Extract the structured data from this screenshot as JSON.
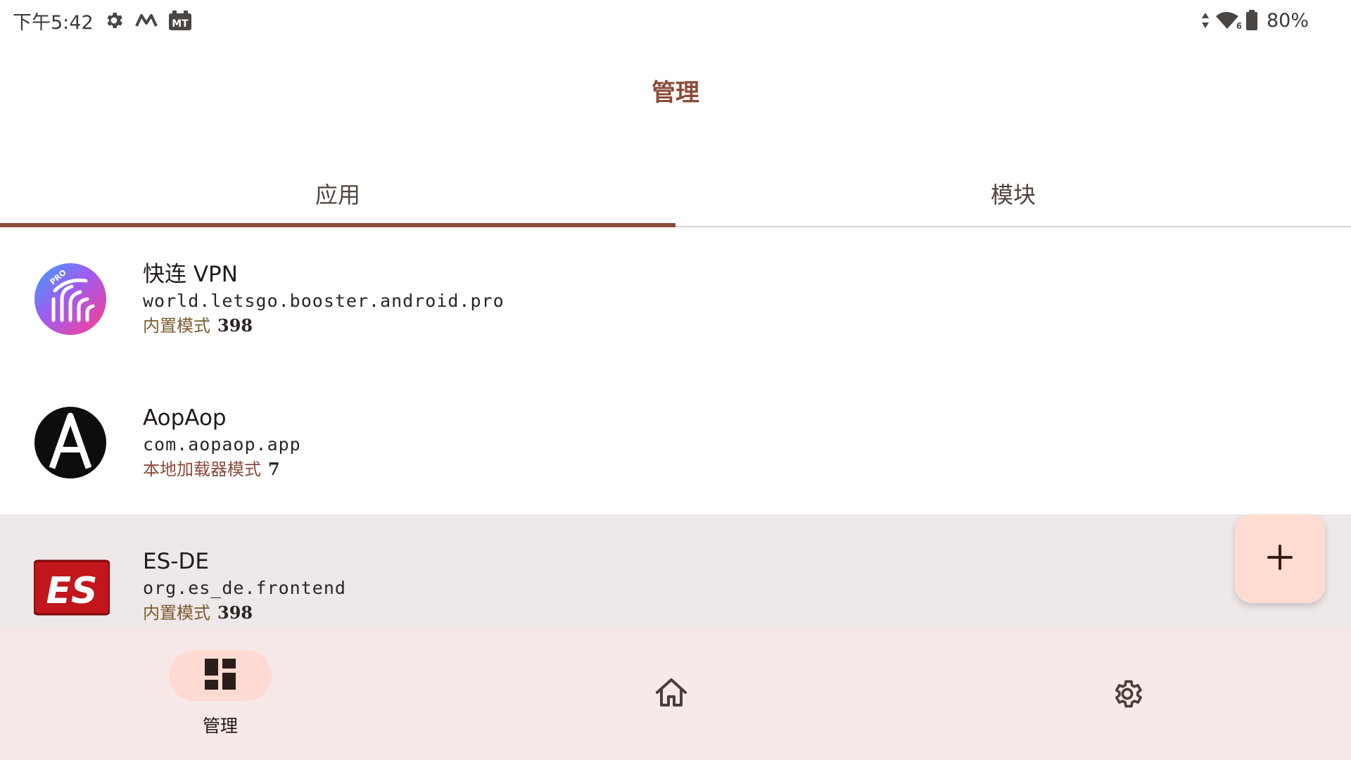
{
  "status_bar": {
    "time": "下午5:42",
    "battery": "80%",
    "icons": [
      "gear-icon",
      "mail-m-icon",
      "mt-manager-icon",
      "data-arrows-icon",
      "wifi-6-icon",
      "battery-icon"
    ]
  },
  "page_title": "管理",
  "tabs": [
    {
      "label": "应用",
      "selected": true
    },
    {
      "label": "模块",
      "selected": false
    }
  ],
  "apps": [
    {
      "name": "快连 VPN",
      "package": "world.letsgo.booster.android.pro",
      "mode": "内置模式",
      "count": "398",
      "icon": "letsvpn-pro-icon"
    },
    {
      "name": "AopAop",
      "package": "com.aopaop.app",
      "mode": "本地加载器模式",
      "count": "7",
      "icon": "aopaop-icon"
    },
    {
      "name": "ES-DE",
      "package": "org.es_de.frontend",
      "mode": "内置模式",
      "count": "398",
      "icon": "es-de-icon"
    }
  ],
  "fab": {
    "icon": "plus-icon"
  },
  "bottom_nav": [
    {
      "label": "管理",
      "icon": "dashboard-icon",
      "selected": true
    },
    {
      "label": "",
      "icon": "home-icon",
      "selected": false
    },
    {
      "label": "",
      "icon": "settings-icon",
      "selected": false
    }
  ],
  "colors": {
    "accent": "#8b4a3a",
    "fab_bg": "#ffdcd2",
    "nav_bg": "#f6e9e7",
    "nav_pill": "#ffdad2",
    "highlight_row": "#efe8e8"
  }
}
